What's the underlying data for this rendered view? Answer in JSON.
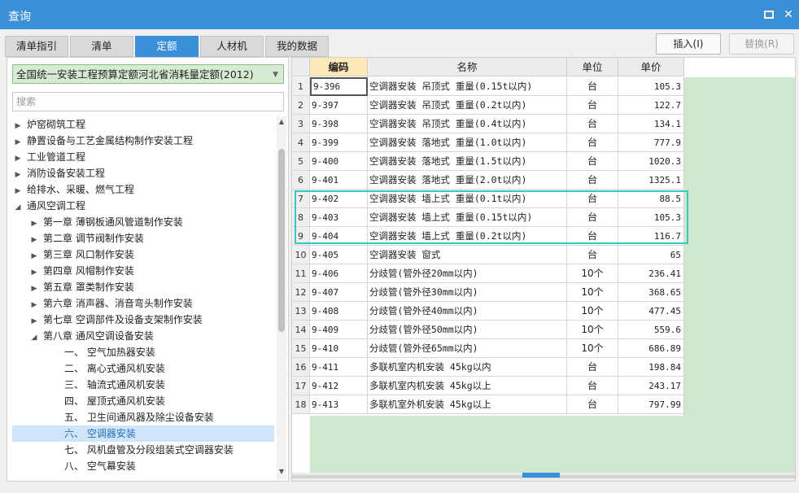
{
  "window": {
    "title": "查询"
  },
  "tabs": [
    "清单指引",
    "清单",
    "定额",
    "人材机",
    "我的数据"
  ],
  "buttons": {
    "insert": "插入(I)",
    "replace": "替换(R)"
  },
  "left": {
    "library": "全国统一安装工程预算定额河北省消耗量定额(2012)",
    "search_placeholder": "搜索",
    "tree": [
      {
        "label": "炉窑砌筑工程",
        "level": 0,
        "toggle": "▶"
      },
      {
        "label": "静置设备与工艺金属结构制作安装工程",
        "level": 0,
        "toggle": "▶"
      },
      {
        "label": "工业管道工程",
        "level": 0,
        "toggle": "▶"
      },
      {
        "label": "消防设备安装工程",
        "level": 0,
        "toggle": "▶"
      },
      {
        "label": "给排水、采暖、燃气工程",
        "level": 0,
        "toggle": "▶"
      },
      {
        "label": "通风空调工程",
        "level": 0,
        "toggle": "◢"
      },
      {
        "label": "第一章 薄钢板通风管道制作安装",
        "level": 1,
        "toggle": "▶"
      },
      {
        "label": "第二章 调节阀制作安装",
        "level": 1,
        "toggle": "▶"
      },
      {
        "label": "第三章 风口制作安装",
        "level": 1,
        "toggle": "▶"
      },
      {
        "label": "第四章 风帽制作安装",
        "level": 1,
        "toggle": "▶"
      },
      {
        "label": "第五章 罩类制作安装",
        "level": 1,
        "toggle": "▶"
      },
      {
        "label": "第六章 消声器、消音弯头制作安装",
        "level": 1,
        "toggle": "▶"
      },
      {
        "label": "第七章 空调部件及设备支架制作安装",
        "level": 1,
        "toggle": "▶"
      },
      {
        "label": "第八章 通风空调设备安装",
        "level": 1,
        "toggle": "◢"
      },
      {
        "label": "一、 空气加热器安装",
        "level": 2,
        "toggle": ""
      },
      {
        "label": "二、 离心式通风机安装",
        "level": 2,
        "toggle": ""
      },
      {
        "label": "三、 轴流式通风机安装",
        "level": 2,
        "toggle": ""
      },
      {
        "label": "四、 屋顶式通风机安装",
        "level": 2,
        "toggle": ""
      },
      {
        "label": "五、 卫生间通风器及除尘设备安装",
        "level": 2,
        "toggle": ""
      },
      {
        "label": "六、 空调器安装",
        "level": 2,
        "toggle": "",
        "selected": true
      },
      {
        "label": "七、 风机盘管及分段组装式空调器安装",
        "level": 2,
        "toggle": ""
      },
      {
        "label": "八、 空气幕安装",
        "level": 2,
        "toggle": ""
      }
    ]
  },
  "table": {
    "headers": {
      "code": "编码",
      "name": "名称",
      "unit": "单位",
      "price": "单价"
    },
    "rows": [
      {
        "n": "1",
        "code": "9-396",
        "name": "空调器安装 吊顶式 重量(0.15t以内)",
        "unit": "台",
        "price": "105.3"
      },
      {
        "n": "2",
        "code": "9-397",
        "name": "空调器安装 吊顶式 重量(0.2t以内)",
        "unit": "台",
        "price": "122.7"
      },
      {
        "n": "3",
        "code": "9-398",
        "name": "空调器安装 吊顶式 重量(0.4t以内)",
        "unit": "台",
        "price": "134.1"
      },
      {
        "n": "4",
        "code": "9-399",
        "name": "空调器安装 落地式 重量(1.0t以内)",
        "unit": "台",
        "price": "777.9"
      },
      {
        "n": "5",
        "code": "9-400",
        "name": "空调器安装 落地式 重量(1.5t以内)",
        "unit": "台",
        "price": "1020.3"
      },
      {
        "n": "6",
        "code": "9-401",
        "name": "空调器安装 落地式 重量(2.0t以内)",
        "unit": "台",
        "price": "1325.1"
      },
      {
        "n": "7",
        "code": "9-402",
        "name": "空调器安装 墙上式 重量(0.1t以内)",
        "unit": "台",
        "price": "88.5"
      },
      {
        "n": "8",
        "code": "9-403",
        "name": "空调器安装 墙上式 重量(0.15t以内)",
        "unit": "台",
        "price": "105.3"
      },
      {
        "n": "9",
        "code": "9-404",
        "name": "空调器安装 墙上式 重量(0.2t以内)",
        "unit": "台",
        "price": "116.7"
      },
      {
        "n": "10",
        "code": "9-405",
        "name": "空调器安装 窗式",
        "unit": "台",
        "price": "65"
      },
      {
        "n": "11",
        "code": "9-406",
        "name": "分歧管(管外径20mm以内)",
        "unit": "10个",
        "price": "236.41"
      },
      {
        "n": "12",
        "code": "9-407",
        "name": "分歧管(管外径30mm以内)",
        "unit": "10个",
        "price": "368.65"
      },
      {
        "n": "13",
        "code": "9-408",
        "name": "分歧管(管外径40mm以内)",
        "unit": "10个",
        "price": "477.45"
      },
      {
        "n": "14",
        "code": "9-409",
        "name": "分歧管(管外径50mm以内)",
        "unit": "10个",
        "price": "559.6"
      },
      {
        "n": "15",
        "code": "9-410",
        "name": "分歧管(管外径65mm以内)",
        "unit": "10个",
        "price": "686.89"
      },
      {
        "n": "16",
        "code": "9-411",
        "name": "多联机室内机安装 45kg以内",
        "unit": "台",
        "price": "198.84"
      },
      {
        "n": "17",
        "code": "9-412",
        "name": "多联机室内机安装 45kg以上",
        "unit": "台",
        "price": "243.17"
      },
      {
        "n": "18",
        "code": "9-413",
        "name": "多联机室外机安装 45kg以上",
        "unit": "台",
        "price": "797.99"
      }
    ]
  }
}
